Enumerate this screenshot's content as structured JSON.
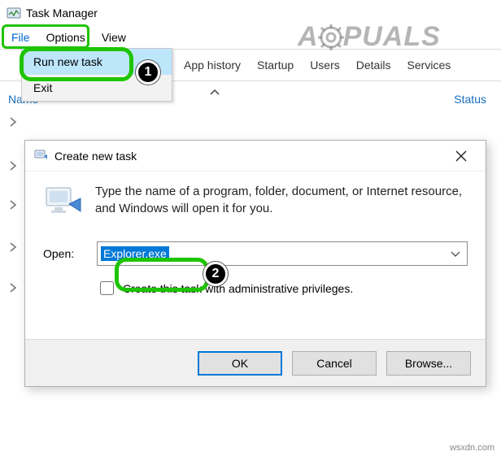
{
  "app": {
    "title": "Task Manager"
  },
  "menubar": {
    "file": "File",
    "options": "Options",
    "view": "View"
  },
  "file_menu": {
    "run_new_task": "Run new task",
    "exit": "Exit"
  },
  "tabs": {
    "app_history": "App history",
    "startup": "Startup",
    "users": "Users",
    "details": "Details",
    "services": "Services"
  },
  "columns": {
    "name": "Name",
    "status": "Status"
  },
  "dialog": {
    "title": "Create new task",
    "prompt": "Type the name of a program, folder, document, or Internet resource, and Windows will open it for you.",
    "open_label": "Open:",
    "open_value": "Explorer.exe",
    "admin_label": "Create this task with administrative privileges.",
    "ok": "OK",
    "cancel": "Cancel",
    "browse": "Browse..."
  },
  "badges": {
    "one": "1",
    "two": "2"
  },
  "watermark": {
    "left": "A",
    "right": "PUALS"
  },
  "credit": "wsxdn.com"
}
